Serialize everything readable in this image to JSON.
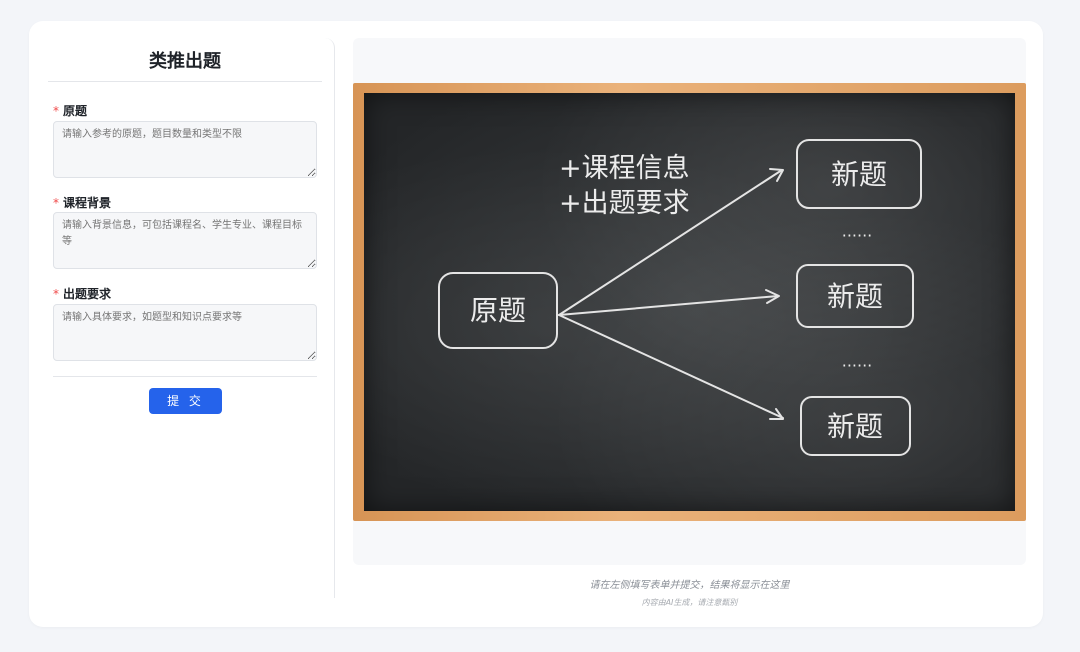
{
  "form": {
    "title": "类推出题",
    "submit_label": "提 交",
    "fields": [
      {
        "label": "原题",
        "required_mark": "*",
        "placeholder": "请输入参考的原题，题目数量和类型不限"
      },
      {
        "label": "课程背景",
        "required_mark": "*",
        "placeholder": "请输入背景信息，可包括课程名、学生专业、课程目标等"
      },
      {
        "label": "出题要求",
        "required_mark": "*",
        "placeholder": "请输入具体要求，如题型和知识点要求等"
      }
    ]
  },
  "preview": {
    "blackboard": {
      "source_label": "原题",
      "annotation_lines": [
        "+课程信息",
        "+出题要求"
      ],
      "target_labels": [
        "新题",
        "新题",
        "新题"
      ],
      "ellipsis": "······"
    },
    "hint": "请在左侧填写表单并提交，结果将显示在这里",
    "disclaimer": "内容由AI生成，请注意甄别"
  },
  "colors": {
    "page_background": "#f3f5f9",
    "accent": "#2563eb",
    "required_mark": "#f04a4a",
    "chalkboard": "#2f3234",
    "frame_wood": "#e3a56a"
  }
}
